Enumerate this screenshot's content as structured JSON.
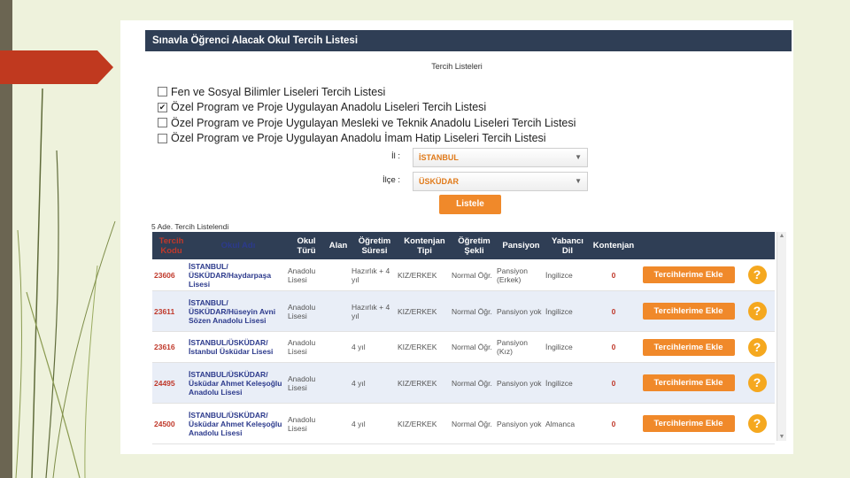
{
  "page": {
    "title": "Sınavla Öğrenci Alacak Okul Tercih Listesi",
    "list_caption": "Tercih Listeleri"
  },
  "options": [
    {
      "label": "Fen ve Sosyal Bilimler Liseleri Tercih Listesi",
      "checked": false
    },
    {
      "label": "Özel Program ve Proje Uygulayan Anadolu Liseleri Tercih Listesi",
      "checked": true
    },
    {
      "label": "Özel Program ve Proje Uygulayan Mesleki ve Teknik Anadolu Liseleri Tercih Listesi",
      "checked": false
    },
    {
      "label": "Özel Program ve Proje Uygulayan Anadolu İmam Hatip Liseleri Tercih Listesi",
      "checked": false
    }
  ],
  "filters": {
    "il_label": "İl :",
    "il_value": "İSTANBUL",
    "ilce_label": "İlçe :",
    "ilce_value": "ÜSKÜDAR",
    "list_button": "Listele"
  },
  "result_count": "5 Ade. Tercih Listelendi",
  "table": {
    "headers": [
      "Tercih Kodu",
      "Okul Adı",
      "Okul Türü",
      "Alan",
      "Öğretim Süresi",
      "Kontenjan Tipi",
      "Öğretim Şekli",
      "Pansiyon",
      "Yabancı Dil",
      "Kontenjan"
    ],
    "rows": [
      {
        "code": "23606",
        "name": "İSTANBUL/ ÜSKÜDAR/Haydarpaşa Lisesi",
        "type": "Anadolu Lisesi",
        "alan": "",
        "duration": "Hazırlık + 4 yıl",
        "quota_type": "KIZ/ERKEK",
        "schedule": "Normal Öğr.",
        "pension": "Pansiyon (Erkek)",
        "language": "İngilizce",
        "quota": "0",
        "add": "Tercihlerime Ekle",
        "help": "?"
      },
      {
        "code": "23611",
        "name": "İSTANBUL/ ÜSKÜDAR/Hüseyin Avni Sözen Anadolu Lisesi",
        "type": "Anadolu Lisesi",
        "alan": "",
        "duration": "Hazırlık + 4 yıl",
        "quota_type": "KIZ/ERKEK",
        "schedule": "Normal Öğr.",
        "pension": "Pansiyon yok",
        "language": "İngilizce",
        "quota": "0",
        "add": "Tercihlerime Ekle",
        "help": "?"
      },
      {
        "code": "23616",
        "name": "İSTANBUL/ÜSKÜDAR/ İstanbul Üsküdar Lisesi",
        "type": "Anadolu Lisesi",
        "alan": "",
        "duration": "4 yıl",
        "quota_type": "KIZ/ERKEK",
        "schedule": "Normal Öğr.",
        "pension": "Pansiyon (Kız)",
        "language": "İngilizce",
        "quota": "0",
        "add": "Tercihlerime Ekle",
        "help": "?"
      },
      {
        "code": "24495",
        "name": "İSTANBUL/ÜSKÜDAR/ Üsküdar Ahmet Keleşoğlu Anadolu Lisesi",
        "type": "Anadolu Lisesi",
        "alan": "",
        "duration": "4 yıl",
        "quota_type": "KIZ/ERKEK",
        "schedule": "Normal Öğr.",
        "pension": "Pansiyon yok",
        "language": "İngilizce",
        "quota": "0",
        "add": "Tercihlerime Ekle",
        "help": "?"
      },
      {
        "code": "24500",
        "name": "İSTANBUL/ÜSKÜDAR/ Üsküdar Ahmet Keleşoğlu Anadolu Lisesi",
        "type": "Anadolu Lisesi",
        "alan": "",
        "duration": "4 yıl",
        "quota_type": "KIZ/ERKEK",
        "schedule": "Normal Öğr.",
        "pension": "Pansiyon yok",
        "language": "Almanca",
        "quota": "0",
        "add": "Tercihlerime Ekle",
        "help": "?"
      }
    ]
  },
  "colors": {
    "header_bg": "#2f3e55",
    "accent_orange": "#f0892a",
    "code_red": "#c0392b",
    "name_blue": "#2c3a8c"
  },
  "icons": {
    "checkbox": "checkbox-icon",
    "help": "question-mark-icon",
    "dropdown": "chevron-down-icon"
  }
}
